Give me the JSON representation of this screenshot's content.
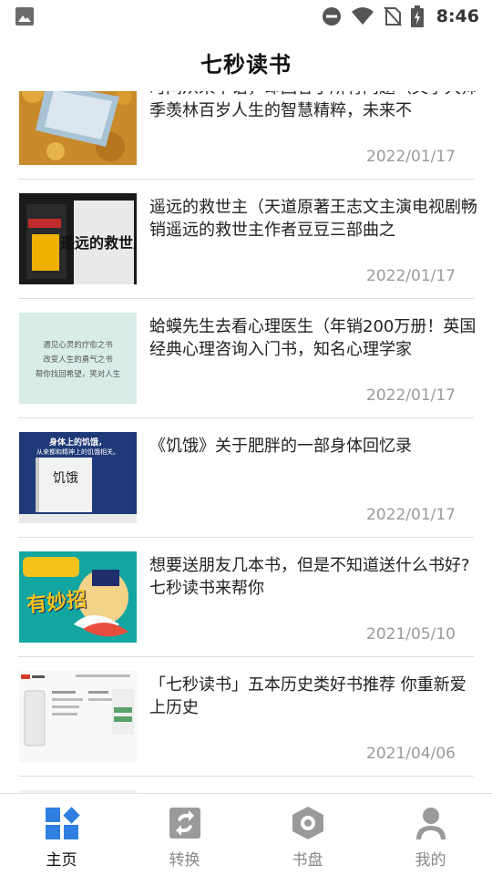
{
  "status": {
    "time": "8:46",
    "icons": [
      "image-icon",
      "dnd-icon",
      "wifi-icon",
      "no-sim-icon",
      "battery-icon"
    ]
  },
  "header": {
    "title": "七秒读书"
  },
  "feed": {
    "items": [
      {
        "title": "时间从来不语，却回答了所有问题（文学大师季羡林百岁人生的智慧精粹，未来不",
        "date": "2022/01/17",
        "thumb": "book-on-leaves-thumbnail"
      },
      {
        "title": "遥远的救世主（天道原著王志文主演电视剧畅销遥远的救世主作者豆豆三部曲之",
        "date": "2022/01/17",
        "thumb": "saviour-book-cover-thumbnail"
      },
      {
        "title": "蛤蟆先生去看心理医生（年销200万册！英国经典心理咨询入门书，知名心理学家",
        "date": "2022/01/17",
        "thumb": "psychology-quote-thumbnail"
      },
      {
        "title": "《饥饿》关于肥胖的一部身体回忆录",
        "date": "2022/01/17",
        "thumb": "hunger-book-cover-thumbnail"
      },
      {
        "title": "想要送朋友几本书，但是不知道送什么书好? 七秒读书来帮你",
        "date": "2021/05/10",
        "thumb": "gift-books-illustration-thumbnail"
      },
      {
        "title": "「七秒读书」五本历史类好书推荐 你重新爱上历史",
        "date": "2021/04/06",
        "thumb": "app-screenshot-thumbnail"
      }
    ],
    "thumb_text": {
      "saviour_cover_title": "遥远的救世主",
      "psych_lines": [
        "遇见心灵的疗愈之书",
        "改变人生的勇气之书",
        "帮你找回希望，笑对人生"
      ],
      "hunger_top": "身体上的饥饿，",
      "hunger_sub": "从来都和精神上的饥饿相关。",
      "hunger_title": "饥饿",
      "gift_label": "有妙招"
    }
  },
  "bottom_nav": {
    "items": [
      {
        "label": "主页",
        "icon": "home-grid-icon",
        "active": true
      },
      {
        "label": "转换",
        "icon": "convert-icon",
        "active": false
      },
      {
        "label": "书盘",
        "icon": "bookshelf-icon",
        "active": false
      },
      {
        "label": "我的",
        "icon": "profile-icon",
        "active": false
      }
    ]
  },
  "colors": {
    "accent": "#2f7fe0",
    "inactive": "#9a9a9a",
    "divider": "#dcdcdc"
  }
}
